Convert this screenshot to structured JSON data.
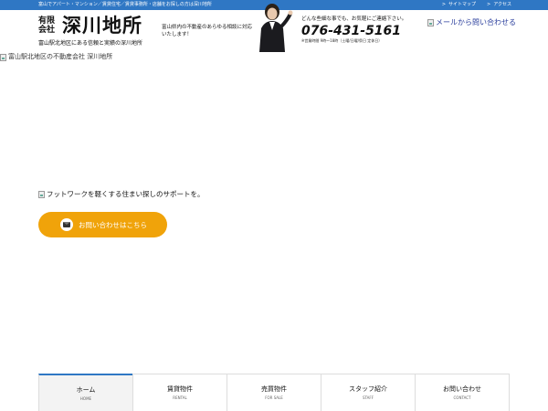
{
  "topbar": {
    "tagline": "富山でアパート・マンション／賃貸住宅／賃貸事務所・店舗をお探しの方は深川地所",
    "links": [
      {
        "label": "サイトマップ"
      },
      {
        "label": "アクセス"
      }
    ],
    "link_marker": ">"
  },
  "header": {
    "logo_small": "有限会社",
    "logo_big": "深川地所",
    "logo_sub": "富山駅北地区にある信頼と実績の深川地所",
    "desc": "富山県内の不動産のあらゆる相談に対応いたします！",
    "contact_note": "どんな些細な事でも、お気軽にご連絡下さい。",
    "phone": "076-431-5161",
    "hours": "※営業時間 9時〜18時（土曜/日曜/祭日 定休日）",
    "mail_link": "メールから問い合わせる"
  },
  "hero": {
    "image_alt": "富山駅北地区の不動産会社 深川地所",
    "tagline_alt": "フットワークを軽くする住まい探しのサポートを。",
    "cta_label": "お問い合わせはこちら"
  },
  "nav": {
    "items": [
      {
        "label": "ホーム",
        "sub": "HOME"
      },
      {
        "label": "賃貸物件",
        "sub": "RENTAL"
      },
      {
        "label": "売買物件",
        "sub": "FOR SALE"
      },
      {
        "label": "スタッフ紹介",
        "sub": "STAFF"
      },
      {
        "label": "お問い合わせ",
        "sub": "CONTACT"
      }
    ]
  },
  "colors": {
    "topbar": "#2f77c4",
    "cta": "#f0a30a",
    "link": "#2a3e9c"
  }
}
